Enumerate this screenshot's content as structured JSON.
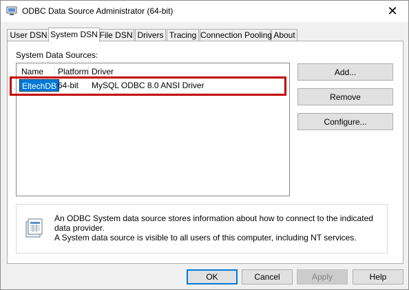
{
  "window": {
    "title": "ODBC Data Source Administrator (64-bit)"
  },
  "tabs": [
    {
      "label": "User DSN"
    },
    {
      "label": "System DSN"
    },
    {
      "label": "File DSN"
    },
    {
      "label": "Drivers"
    },
    {
      "label": "Tracing"
    },
    {
      "label": "Connection Pooling"
    },
    {
      "label": "About"
    }
  ],
  "active_tab": "System DSN",
  "system_dsn": {
    "group_label": "System Data Sources:",
    "columns": [
      "Name",
      "Platform",
      "Driver"
    ],
    "rows": [
      {
        "name": "EltechDB",
        "platform": "64-bit",
        "driver": "MySQL ODBC 8.0 ANSI Driver",
        "selected": true
      }
    ],
    "buttons": {
      "add": "Add...",
      "remove": "Remove",
      "configure": "Configure..."
    },
    "info_text_line1": "An ODBC System data source stores information about how to connect to the indicated data provider.",
    "info_text_line2": "A System data source is visible to all users of this computer, including NT services."
  },
  "footer": {
    "ok": "OK",
    "cancel": "Cancel",
    "apply": "Apply",
    "help": "Help"
  },
  "colors": {
    "selection": "#0078d7",
    "highlight_border": "#c00000",
    "default_button_border": "#0078d7"
  }
}
